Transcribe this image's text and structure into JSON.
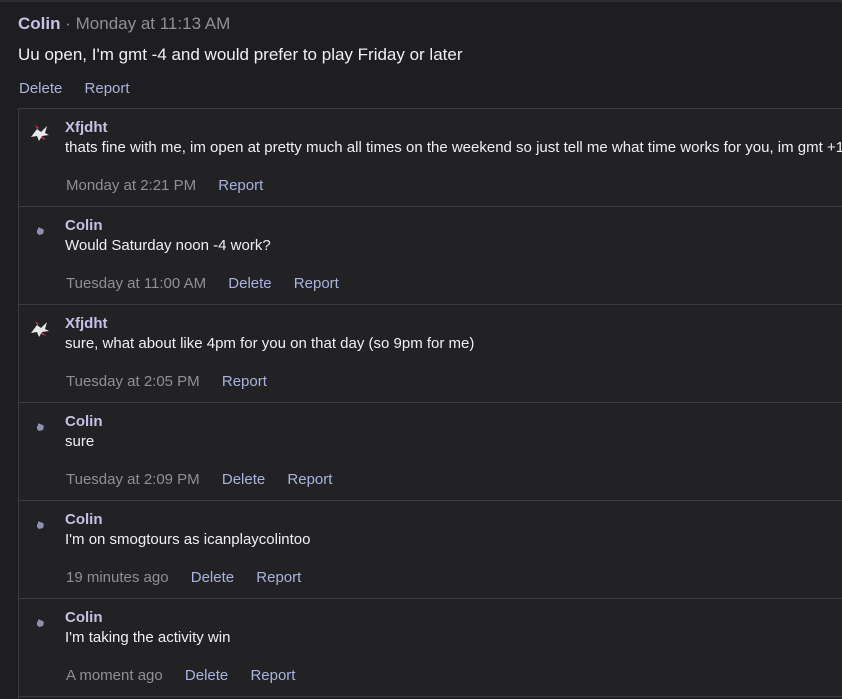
{
  "post": {
    "author": "Colin",
    "separator": "·",
    "time": "Monday at 11:13 AM",
    "body": "Uu open, I'm gmt -4 and would prefer to play Friday or later",
    "delete_label": "Delete",
    "report_label": "Report"
  },
  "replies": [
    {
      "author": "Xfjdht",
      "text": "thats fine with me, im open at pretty much all times on the weekend so just tell me what time works for you, im gmt +1",
      "time": "Monday at 2:21 PM",
      "report": "Report",
      "avatar": "dragon-avatar-icon"
    },
    {
      "author": "Colin",
      "text": "Would Saturday noon -4 work?",
      "time": "Tuesday at 11:00 AM",
      "delete": "Delete",
      "report": "Report",
      "avatar": "small-creature-avatar-icon"
    },
    {
      "author": "Xfjdht",
      "text": "sure, what about like 4pm for you on that day (so 9pm for me)",
      "time": "Tuesday at 2:05 PM",
      "report": "Report",
      "avatar": "dragon-avatar-icon"
    },
    {
      "author": "Colin",
      "text": "sure",
      "time": "Tuesday at 2:09 PM",
      "delete": "Delete",
      "report": "Report",
      "avatar": "small-creature-avatar-icon"
    },
    {
      "author": "Colin",
      "text": "I'm on smogtours as icanplaycolintoo",
      "time": "19 minutes ago",
      "delete": "Delete",
      "report": "Report",
      "avatar": "small-creature-avatar-icon"
    },
    {
      "author": "Colin",
      "text": "I'm taking the activity win",
      "time": "A moment ago",
      "delete": "Delete",
      "report": "Report",
      "avatar": "small-creature-avatar-icon"
    }
  ],
  "colors": {
    "background": "#1e1e21",
    "author": "#c9bfe7",
    "link": "#a9b3e0",
    "muted": "#8f8f96"
  }
}
